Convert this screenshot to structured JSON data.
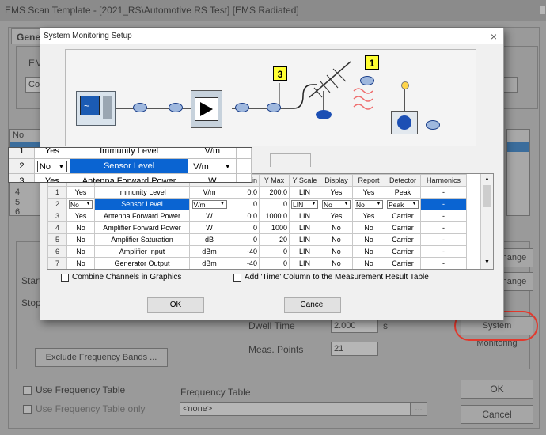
{
  "bg": {
    "title": "EMS Scan Template - [2021_RS\\Automotive  RS Test] [EMS Radiated]",
    "tab_general": "Gene",
    "label_ems": "EMS",
    "field_co": "Co",
    "list_header_no": "No",
    "list_rows": [
      "3",
      "4",
      "5",
      "6"
    ],
    "label_start": "Start",
    "label_stop": "Stop",
    "label_dwell_time": "Dwell Time",
    "dwell_time_value": "2.000",
    "dwell_time_unit": "s",
    "label_meas_points": "Meas. Points",
    "meas_points_value": "21",
    "exclude_button": "Exclude Frequency Bands ...",
    "use_freq_table": "Use Frequency Table",
    "use_freq_table_only": "Use Frequency Table only",
    "freq_table_label": "Frequency Table",
    "freq_table_value": "<none>",
    "browse_button": "...",
    "change_button_1": "Change",
    "change_button_2": "Change",
    "system_monitoring_button": "System Monitoring",
    "ok_button": "OK",
    "cancel_button": "Cancel",
    "highlight_color": "#e3392d"
  },
  "dialog": {
    "title": "System Monitoring Setup",
    "close_glyph": "×",
    "badges": [
      "3",
      "1"
    ],
    "columns": [
      "",
      "",
      "",
      "",
      "Min",
      "Y Max",
      "Y Scale",
      "Display",
      "Report",
      "Detector",
      "Harmonics"
    ],
    "rows": [
      {
        "no": "1",
        "enabled": "Yes",
        "name": "Immunity Level",
        "unit": "V/m",
        "ymin": "0.0",
        "ymax": "200.0",
        "yscale": "LIN",
        "display": "Yes",
        "report": "Yes",
        "detector": "Peak",
        "harmonics": "-"
      },
      {
        "no": "2",
        "enabled": "No",
        "name": "Sensor Level",
        "unit": "V/m",
        "ymin": "0",
        "ymax": "0",
        "yscale": "LIN",
        "display": "No",
        "report": "No",
        "detector": "Peak",
        "harmonics": "-"
      },
      {
        "no": "3",
        "enabled": "Yes",
        "name": "Antenna Forward Power",
        "unit": "W",
        "ymin": "0.0",
        "ymax": "1000.0",
        "yscale": "LIN",
        "display": "Yes",
        "report": "Yes",
        "detector": "Carrier",
        "harmonics": "-"
      },
      {
        "no": "4",
        "enabled": "No",
        "name": "Amplifier Forward Power",
        "unit": "W",
        "ymin": "0",
        "ymax": "1000",
        "yscale": "LIN",
        "display": "No",
        "report": "No",
        "detector": "Carrier",
        "harmonics": "-"
      },
      {
        "no": "5",
        "enabled": "No",
        "name": "Amplifier Saturation",
        "unit": "dB",
        "ymin": "0",
        "ymax": "20",
        "yscale": "LIN",
        "display": "No",
        "report": "No",
        "detector": "Carrier",
        "harmonics": "-"
      },
      {
        "no": "6",
        "enabled": "No",
        "name": "Amplifier Input",
        "unit": "dBm",
        "ymin": "-40",
        "ymax": "0",
        "yscale": "LIN",
        "display": "No",
        "report": "No",
        "detector": "Carrier",
        "harmonics": "-"
      },
      {
        "no": "7",
        "enabled": "No",
        "name": "Generator Output",
        "unit": "dBm",
        "ymin": "-40",
        "ymax": "0",
        "yscale": "LIN",
        "display": "No",
        "report": "No",
        "detector": "Carrier",
        "harmonics": "-"
      }
    ],
    "combine_channels": "Combine Channels in Graphics",
    "add_time_column": "Add 'Time' Column to the Measurement Result Table",
    "ok_button": "OK",
    "cancel_button": "Cancel",
    "selection_color": "#0a64d2"
  },
  "zoom": {
    "rows": [
      {
        "no": "1",
        "enabled": "Yes",
        "name": "Immunity Level",
        "unit": "V/m"
      },
      {
        "no": "2",
        "enabled": "No",
        "name": "Sensor Level",
        "unit": "V/m"
      },
      {
        "no": "3",
        "enabled": "Yes",
        "name": "Antenna Forward Power",
        "unit": "W"
      }
    ]
  }
}
